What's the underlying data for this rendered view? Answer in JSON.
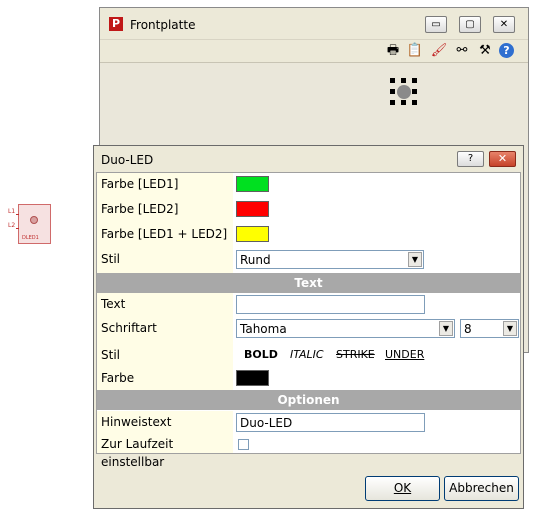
{
  "component": {
    "pin1": "L1",
    "pin2": "L2",
    "label": "DLED1"
  },
  "frontplatte": {
    "title": "Frontplatte",
    "window_buttons": {
      "minimize": "▭",
      "restore": "▢",
      "close": "✕"
    },
    "toolbar": [
      {
        "name": "print",
        "glyph": "🖶"
      },
      {
        "name": "paste",
        "glyph": "📋"
      },
      {
        "name": "brush",
        "glyph": "🖌"
      },
      {
        "name": "link",
        "glyph": "⚯"
      },
      {
        "name": "tools",
        "glyph": "⚒"
      },
      {
        "name": "help",
        "glyph": "?"
      }
    ]
  },
  "dialog": {
    "title": "Duo-LED",
    "help_label": "?",
    "close_label": "✕",
    "rows": {
      "led1": {
        "label": "Farbe [LED1]",
        "color": "#00e020"
      },
      "led2": {
        "label": "Farbe [LED2]",
        "color": "#ff0000"
      },
      "led12": {
        "label": "Farbe [LED1 + LED2]",
        "color": "#ffff00"
      },
      "stil": {
        "label": "Stil",
        "value": "Rund"
      }
    },
    "section_text": "Text",
    "text": {
      "label": "Text",
      "value": ""
    },
    "schriftart": {
      "label": "Schriftart",
      "value": "Tahoma",
      "size": "8"
    },
    "textstil": {
      "label": "Stil",
      "bold": "BOLD",
      "italic": "ITALIC",
      "strike": "STRIKE",
      "under": "UNDER"
    },
    "farbe": {
      "label": "Farbe",
      "color": "#000000"
    },
    "section_optionen": "Optionen",
    "hinweistext": {
      "label": "Hinweistext",
      "value": "Duo-LED"
    },
    "laufzeit": {
      "label": "Zur Laufzeit einstellbar",
      "checked": false
    },
    "ok_label": "OK",
    "cancel_label": "Abbrechen",
    "arrow": "▼"
  }
}
